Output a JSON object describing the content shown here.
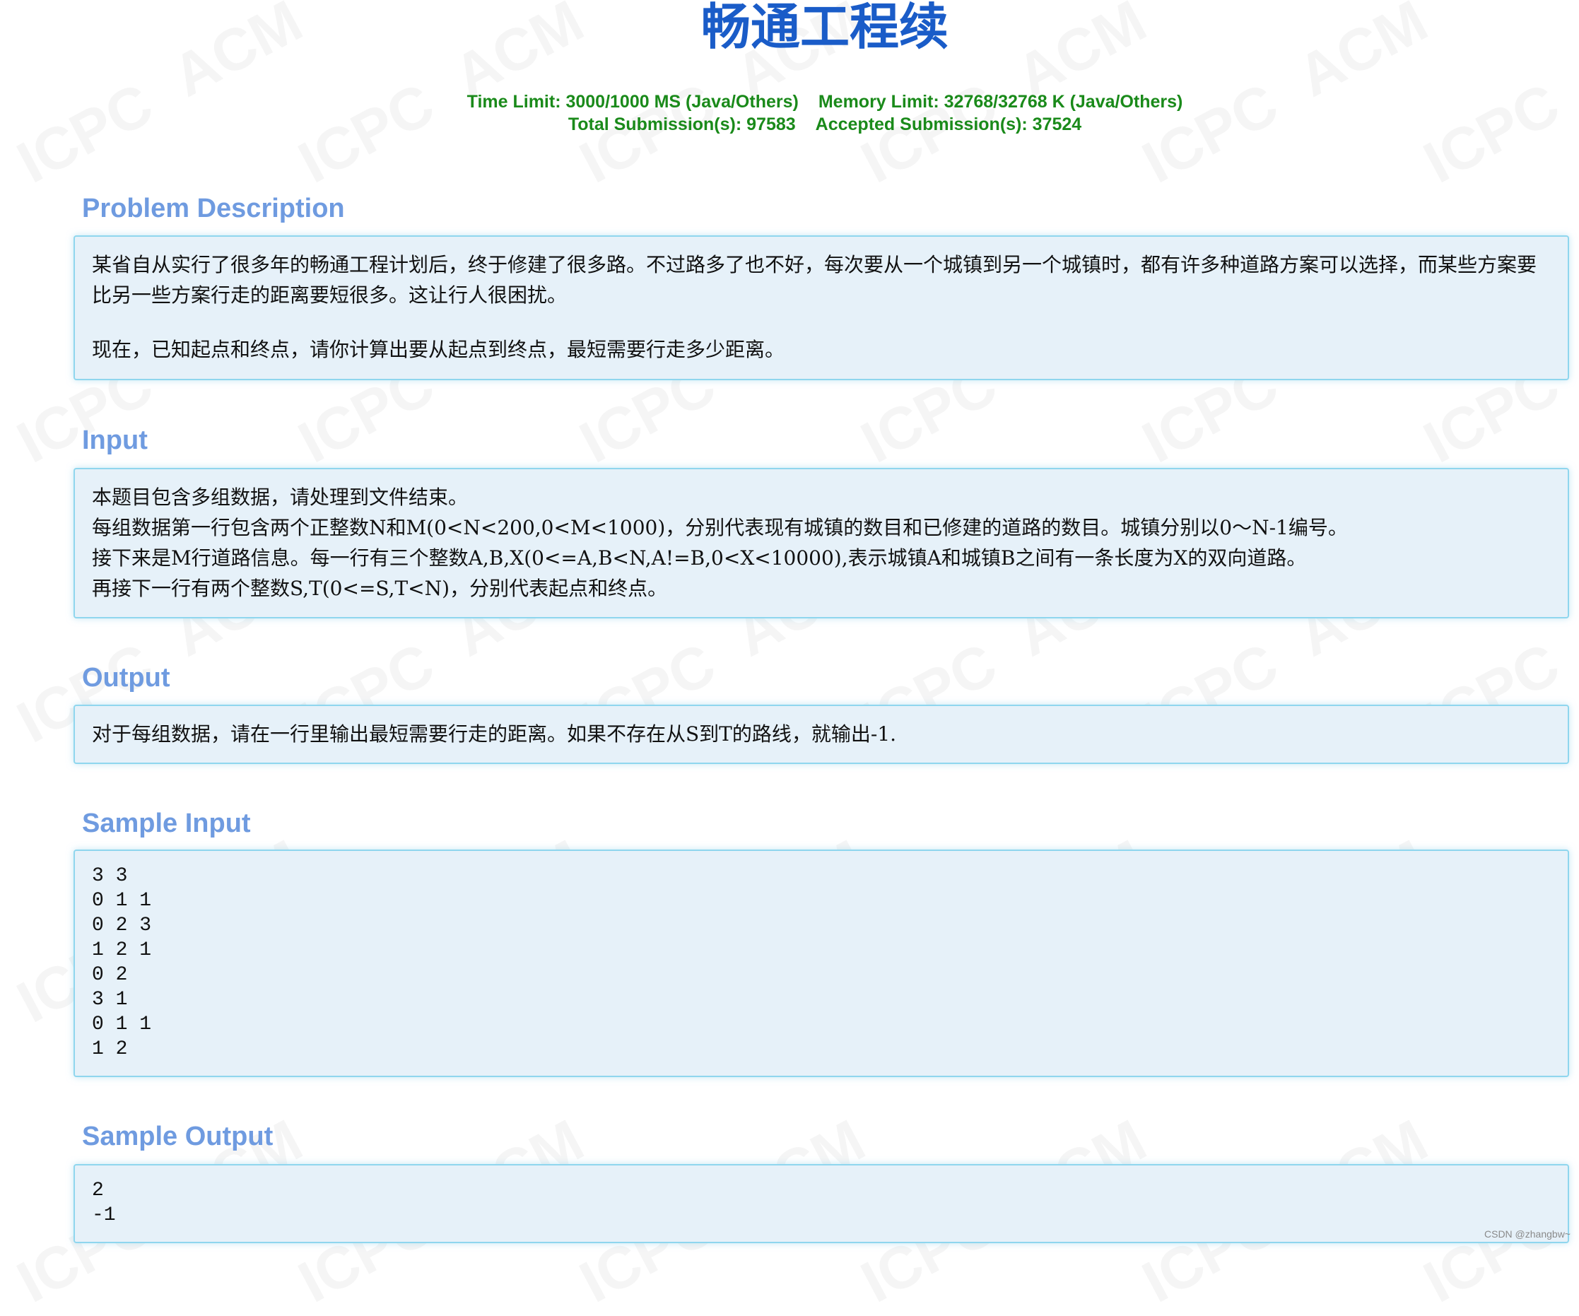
{
  "problem": {
    "title": "畅通工程续",
    "time_limit": "Time Limit: 3000/1000 MS (Java/Others)",
    "memory_limit": "Memory Limit: 32768/32768 K (Java/Others)",
    "total_submissions": "Total Submission(s): 97583",
    "accepted_submissions": "Accepted Submission(s): 37524"
  },
  "sections": {
    "description": {
      "heading": "Problem Description",
      "para1": "某省自从实行了很多年的畅通工程计划后，终于修建了很多路。不过路多了也不好，每次要从一个城镇到另一个城镇时，都有许多种道路方案可以选择，而某些方案要比另一些方案行走的距离要短很多。这让行人很困扰。",
      "para2": "现在，已知起点和终点，请你计算出要从起点到终点，最短需要行走多少距离。"
    },
    "input": {
      "heading": "Input",
      "lines": [
        "本题目包含多组数据，请处理到文件结束。",
        "每组数据第一行包含两个正整数N和M(0<N<200,0<M<1000)，分别代表现有城镇的数目和已修建的道路的数目。城镇分别以0～N-1编号。",
        "接下来是M行道路信息。每一行有三个整数A,B,X(0<=A,B<N,A!=B,0<X<10000),表示城镇A和城镇B之间有一条长度为X的双向道路。",
        "再接下一行有两个整数S,T(0<=S,T<N)，分别代表起点和终点。"
      ]
    },
    "output": {
      "heading": "Output",
      "text": "对于每组数据，请在一行里输出最短需要行走的距离。如果不存在从S到T的路线，就输出-1."
    },
    "sample_input": {
      "heading": "Sample Input",
      "text": "3 3\n0 1 1\n0 2 3\n1 2 1\n0 2\n3 1\n0 1 1\n1 2"
    },
    "sample_output": {
      "heading": "Sample Output",
      "text": "2\n-1"
    }
  },
  "watermark": {
    "text_a": "ACM",
    "text_b": "ICPC"
  },
  "credit": "CSDN @zhangbw~",
  "colors": {
    "title": "#1a5cc8",
    "limits": "#1a8a1a",
    "section_heading": "#6f9be0",
    "panel_bg": "#e6f1f9",
    "panel_border": "#8fd6ee"
  }
}
